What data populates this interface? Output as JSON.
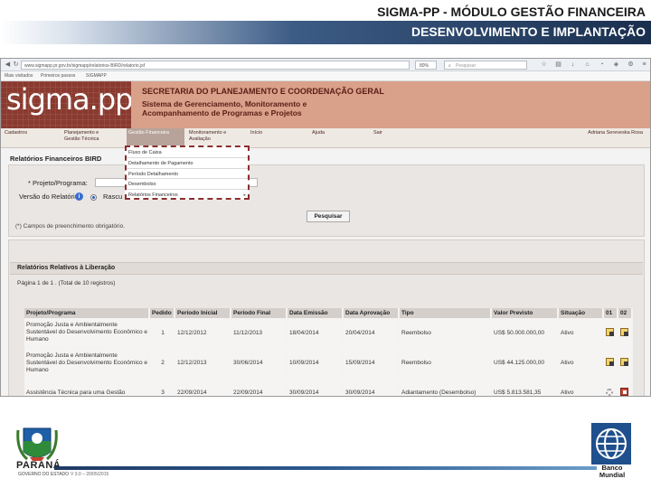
{
  "slide": {
    "title_line1": "SIGMA-PP - MÓDULO GESTÃO FINANCEIRA",
    "title_line2": "DESENVOLVIMENTO E IMPLANTAÇÃO"
  },
  "browser": {
    "url": "www.sigmapp.pr.gov.br/sigmapp/relatorios-BIRD/relatorio.jsf",
    "zoom": "80%",
    "search_placeholder": "Pesquisar",
    "bookmarks": [
      "Mais visitados",
      "Primeiros passos",
      "SIGMAPP"
    ]
  },
  "app": {
    "logo": "sigma.pp",
    "dept_title": "SECRETARIA DO PLANEJAMENTO E COORDENAÇÃO GERAL",
    "system_name": "Sistema de Gerenciamento, Monitoramento e Acompanhamento de Programas e Projetos"
  },
  "menu": {
    "items": [
      "Cadastros",
      "Planejamento e Gestão Técnica",
      "Gestão Financeira",
      "Monitoramento e Avaliação",
      "Início",
      "Ajuda",
      "Sair"
    ],
    "user": "Adriana Sereveska Rosa"
  },
  "dropdown": {
    "items": [
      "Fluxo de Caixa",
      "Detalhamento de Pagamento",
      "Período Detalhamento",
      "Desembolso",
      "Relatórios Financeiros"
    ]
  },
  "filters": {
    "panel_title": "Relatórios Financeiros BIRD",
    "project_label": "* Projeto/Programa:",
    "version_label": "Versão do Relatório",
    "radio_label": "Rascu",
    "search_button": "Pesquisar",
    "required_note": "(*) Campos de preenchimento obrigatório."
  },
  "results": {
    "title": "Relatórios Relativos à Liberação",
    "page_info": "Página 1 de 1 . (Total de 10 registros)",
    "columns": [
      "Projeto/Programa",
      "Pedido",
      "Período Inicial",
      "Período Final",
      "Data Emissão",
      "Data Aprovação",
      "Tipo",
      "Valor Previsto",
      "Situação",
      "01",
      "02"
    ],
    "rows": [
      {
        "project": "Promoção Justa e Ambientalmente Sustentável do Desenvolvimento Econômico e Humano",
        "order": "1",
        "start": "12/12/2012",
        "end": "11/12/2013",
        "issued": "18/04/2014",
        "approved": "20/04/2014",
        "type": "Reembolso",
        "value": "US$ 50.000.000,00",
        "status": "Ativo"
      },
      {
        "project": "Promoção Justa e Ambientalmente Sustentável do Desenvolvimento Econômico e Humano",
        "order": "2",
        "start": "12/12/2013",
        "end": "30/06/2014",
        "issued": "10/09/2014",
        "approved": "15/09/2014",
        "type": "Reembolso",
        "value": "US$ 44.125.000,00",
        "status": "Ativo"
      },
      {
        "project": "Assistência Técnica para uma Gestão",
        "order": "3",
        "start": "22/09/2014",
        "end": "22/09/2014",
        "issued": "30/09/2014",
        "approved": "30/09/2014",
        "type": "Adiantamento (Desembolso)",
        "value": "US$ 5.813.581,35",
        "status": "Ativo"
      }
    ]
  },
  "footer": {
    "state_name": "PARANÁ",
    "state_sub": "GOVERNO DO ESTADO",
    "version": "V 3.0 – 20/05/2015",
    "bank_name": "Banco Mundial"
  }
}
